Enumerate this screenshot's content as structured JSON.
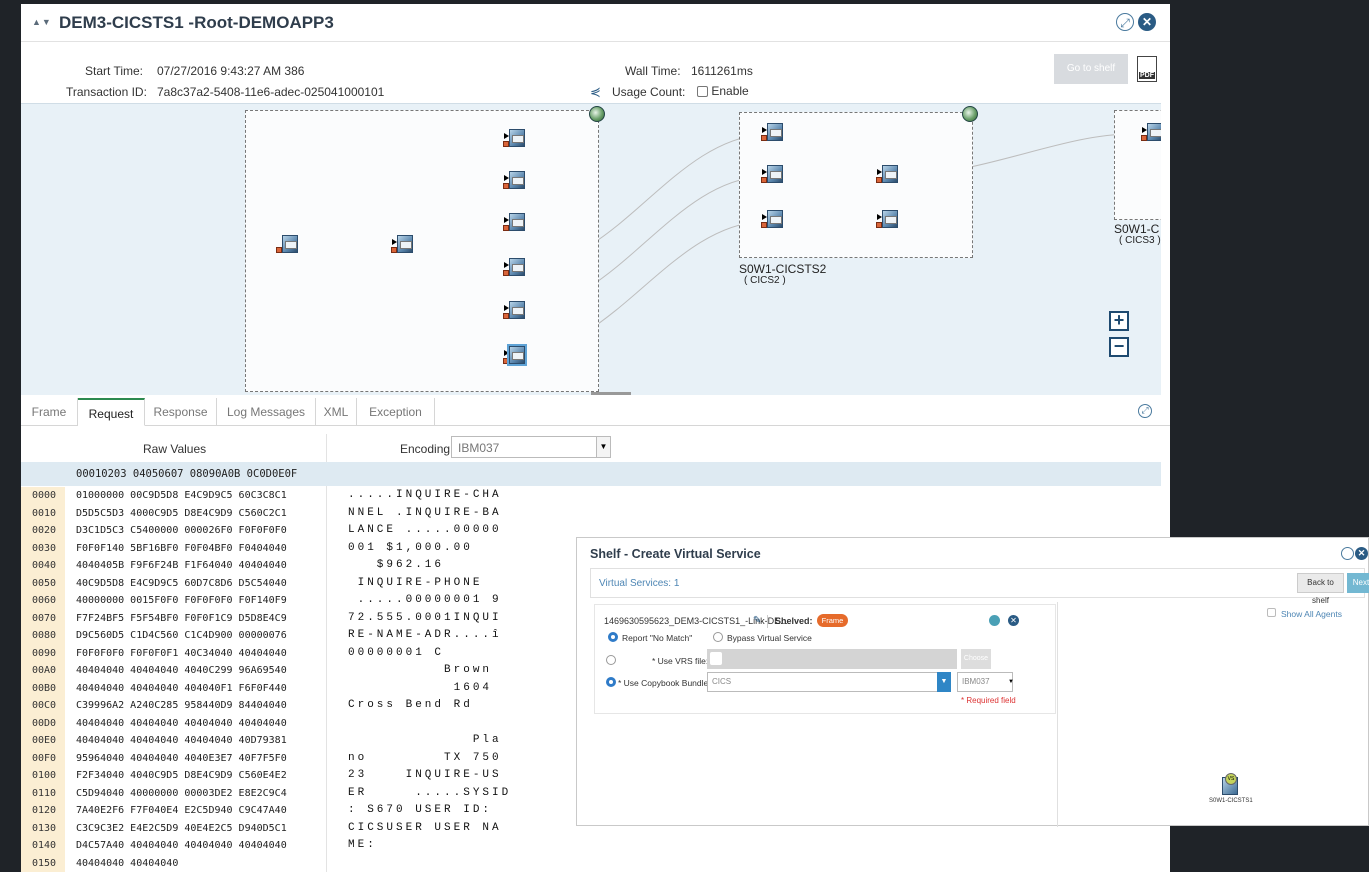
{
  "window": {
    "title": "DEM3-CICSTS1 -Root-DEMOAPP3",
    "start_time_label": "Start Time:",
    "start_time": "07/27/2016 9:43:27 AM 386",
    "transaction_id_label": "Transaction ID:",
    "transaction_id": "7a8c37a2-5408-11e6-adec-025041000101",
    "wall_time_label": "Wall Time:",
    "wall_time": "1611261ms",
    "usage_count_label": "Usage Count:",
    "enable_label": "Enable",
    "go_to_shelf_label": "Go to shelf",
    "pdf_label": "PDF"
  },
  "graph": {
    "groups": [
      {
        "name": "",
        "sub": ""
      },
      {
        "name": "S0W1-CICSTS2",
        "sub": "( CICS2 )"
      },
      {
        "name": "S0W1-C",
        "sub": "( CICS3 )"
      }
    ],
    "zoom_in": "+",
    "zoom_out": "−"
  },
  "tabs": [
    "Frame",
    "Request",
    "Response",
    "Log Messages",
    "XML",
    "Exception"
  ],
  "raw": {
    "title": "Raw Values",
    "encoding_label": "Encoding",
    "encoding_value": "IBM037",
    "header": "00010203 04050607 08090A0B 0C0D0E0F",
    "rows": [
      {
        "off": "0000",
        "hex": "01000000 00C9D5D8 E4C9D9C5 60C3C8C1",
        "text": ".....INQUIRE-CHA"
      },
      {
        "off": "0010",
        "hex": "D5D5C5D3 4000C9D5 D8E4C9D9 C560C2C1",
        "text": "NNEL .INQUIRE-BA"
      },
      {
        "off": "0020",
        "hex": "D3C1D5C3 C5400000 000026F0 F0F0F0F0",
        "text": "LANCE .....00000"
      },
      {
        "off": "0030",
        "hex": "F0F0F140 5BF16BF0 F0F04BF0 F0404040",
        "text": "001 $1,000.00"
      },
      {
        "off": "0040",
        "hex": "4040405B F9F6F24B F1F64040 40404040",
        "text": "   $962.16"
      },
      {
        "off": "0050",
        "hex": "40C9D5D8 E4C9D9C5 60D7C8D6 D5C54040",
        "text": " INQUIRE-PHONE"
      },
      {
        "off": "0060",
        "hex": "40000000 0015F0F0 F0F0F0F0 F0F140F9",
        "text": " .....00000001 9"
      },
      {
        "off": "0070",
        "hex": "F7F24BF5 F5F54BF0 F0F0F1C9 D5D8E4C9",
        "text": "72.555.0001INQUI"
      },
      {
        "off": "0080",
        "hex": "D9C560D5 C1D4C560 C1C4D900 00000076",
        "text": "RE-NAME-ADR....î"
      },
      {
        "off": "0090",
        "hex": "F0F0F0F0 F0F0F0F1 40C34040 40404040",
        "text": "00000001 C"
      },
      {
        "off": "00A0",
        "hex": "40404040 40404040 4040C299 96A69540",
        "text": "          Brown"
      },
      {
        "off": "00B0",
        "hex": "40404040 40404040 404040F1 F6F0F440",
        "text": "           1604"
      },
      {
        "off": "00C0",
        "hex": "C39996A2 A240C285 958440D9 84404040",
        "text": "Cross Bend Rd"
      },
      {
        "off": "00D0",
        "hex": "40404040 40404040 40404040 40404040",
        "text": ""
      },
      {
        "off": "00E0",
        "hex": "40404040 40404040 40404040 40D79381",
        "text": "             Pla"
      },
      {
        "off": "00F0",
        "hex": "95964040 40404040 4040E3E7 40F7F5F0",
        "text": "no        TX 750"
      },
      {
        "off": "0100",
        "hex": "F2F34040 4040C9D5 D8E4C9D9 C560E4E2",
        "text": "23    INQUIRE-US"
      },
      {
        "off": "0110",
        "hex": "C5D94040 40000000 00003DE2 E8E2C9C4",
        "text": "ER     .....SYSID"
      },
      {
        "off": "0120",
        "hex": "7A40E2F6 F7F040E4 E2C5D940 C9C47A40",
        "text": ": S670 USER ID:"
      },
      {
        "off": "0130",
        "hex": "C3C9C3E2 E4E2C5D9 40E4E2C5 D940D5C1",
        "text": "CICSUSER USER NA"
      },
      {
        "off": "0140",
        "hex": "D4C57A40 40404040 40404040 40404040",
        "text": "ME:"
      },
      {
        "off": "0150",
        "hex": "40404040 40404040",
        "text": ""
      }
    ]
  },
  "shelf": {
    "title": "Shelf - Create Virtual Service",
    "virtual_services_label": "Virtual Services: 1",
    "back_to_shelf": "Back to shelf",
    "next": "Next",
    "service_name": "1469630595623_DEM3-CICSTS1_-Link-DE...",
    "shelved_label": "Shelved:",
    "shelved_badge": "Frame",
    "report_no_match": "Report \"No Match\"",
    "bypass_vs": "Bypass Virtual Service",
    "use_vrs_label": "* Use VRS file:",
    "choose_label": "Choose",
    "use_copybook_label": "* Use Copybook Bundle:",
    "copybook_value": "CICS",
    "encoding_value": "IBM037",
    "required_field": "* Required field",
    "show_all_agents": "Show All Agents",
    "agent_node_label": "S0W1-CICSTS1",
    "agent_badge": "VS"
  }
}
